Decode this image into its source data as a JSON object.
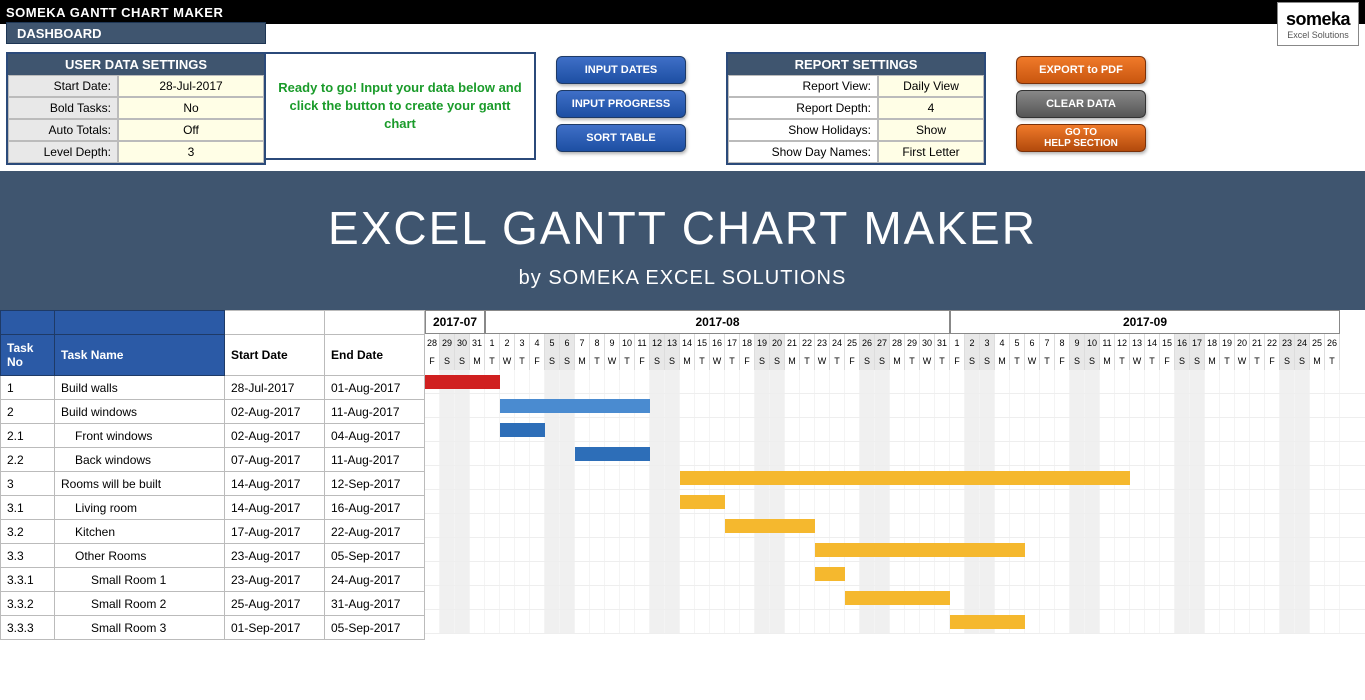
{
  "topbar": {
    "title": "SOMEKA GANTT CHART MAKER"
  },
  "logo": {
    "main": "someka",
    "sub": "Excel Solutions"
  },
  "dashboard_label": "DASHBOARD",
  "user_settings": {
    "header": "USER DATA SETTINGS",
    "rows": [
      {
        "label": "Start Date:",
        "value": "28-Jul-2017"
      },
      {
        "label": "Bold Tasks:",
        "value": "No"
      },
      {
        "label": "Auto Totals:",
        "value": "Off"
      },
      {
        "label": "Level Depth:",
        "value": "3"
      }
    ]
  },
  "message": "Ready to go! Input your data below and click the button to create your gantt chart",
  "buttons_mid": {
    "input_dates": "INPUT DATES",
    "input_progress": "INPUT PROGRESS",
    "sort_table": "SORT TABLE"
  },
  "report_settings": {
    "header": "REPORT SETTINGS",
    "rows": [
      {
        "label": "Report View:",
        "value": "Daily View"
      },
      {
        "label": "Report Depth:",
        "value": "4"
      },
      {
        "label": "Show Holidays:",
        "value": "Show"
      },
      {
        "label": "Show Day Names:",
        "value": "First Letter"
      }
    ]
  },
  "buttons_right": {
    "export": "EXPORT to PDF",
    "clear": "CLEAR DATA",
    "help": "GO TO\nHELP SECTION"
  },
  "hero": {
    "title": "EXCEL GANTT CHART MAKER",
    "subtitle": "by SOMEKA EXCEL SOLUTIONS"
  },
  "columns": {
    "no": "Task No",
    "name": "Task Name",
    "start": "Start Date",
    "end": "End Date"
  },
  "months": [
    {
      "label": "2017-07",
      "days": 4
    },
    {
      "label": "2017-08",
      "days": 31
    },
    {
      "label": "2017-09",
      "days": 26
    }
  ],
  "timeline_start_day": 28,
  "day_numbers": [
    "28",
    "29",
    "30",
    "31",
    "1",
    "2",
    "3",
    "4",
    "5",
    "6",
    "7",
    "8",
    "9",
    "10",
    "11",
    "12",
    "13",
    "14",
    "15",
    "16",
    "17",
    "18",
    "19",
    "20",
    "21",
    "22",
    "23",
    "24",
    "25",
    "26",
    "27",
    "28",
    "29",
    "30",
    "31",
    "1",
    "2",
    "3",
    "4",
    "5",
    "6",
    "7",
    "8",
    "9",
    "10",
    "11",
    "12",
    "13",
    "14",
    "15",
    "16",
    "17",
    "18",
    "19",
    "20",
    "21",
    "22",
    "23",
    "24",
    "25",
    "26"
  ],
  "day_names": [
    "F",
    "S",
    "S",
    "M",
    "T",
    "W",
    "T",
    "F",
    "S",
    "S",
    "M",
    "T",
    "W",
    "T",
    "F",
    "S",
    "S",
    "M",
    "T",
    "W",
    "T",
    "F",
    "S",
    "S",
    "M",
    "T",
    "W",
    "T",
    "F",
    "S",
    "S",
    "M",
    "T",
    "W",
    "T",
    "F",
    "S",
    "S",
    "M",
    "T",
    "W",
    "T",
    "F",
    "S",
    "S",
    "M",
    "T",
    "W",
    "T",
    "F",
    "S",
    "S",
    "M",
    "T",
    "W",
    "T",
    "F",
    "S",
    "S",
    "M",
    "T"
  ],
  "weekends": [
    1,
    2,
    8,
    9,
    15,
    16,
    22,
    23,
    29,
    30,
    36,
    37,
    43,
    44,
    50,
    51,
    57,
    58
  ],
  "tasks": [
    {
      "no": "1",
      "name": "Build walls",
      "indent": 0,
      "start": "28-Jul-2017",
      "end": "01-Aug-2017",
      "bar_start": 0,
      "bar_len": 5,
      "color": "red"
    },
    {
      "no": "2",
      "name": "Build windows",
      "indent": 0,
      "start": "02-Aug-2017",
      "end": "11-Aug-2017",
      "bar_start": 5,
      "bar_len": 10,
      "color": "blue"
    },
    {
      "no": "2.1",
      "name": "Front windows",
      "indent": 1,
      "start": "02-Aug-2017",
      "end": "04-Aug-2017",
      "bar_start": 5,
      "bar_len": 3,
      "color": "blue-dk"
    },
    {
      "no": "2.2",
      "name": "Back windows",
      "indent": 1,
      "start": "07-Aug-2017",
      "end": "11-Aug-2017",
      "bar_start": 10,
      "bar_len": 5,
      "color": "blue-dk"
    },
    {
      "no": "3",
      "name": "Rooms will be built",
      "indent": 0,
      "start": "14-Aug-2017",
      "end": "12-Sep-2017",
      "bar_start": 17,
      "bar_len": 30,
      "color": "orange"
    },
    {
      "no": "3.1",
      "name": "Living room",
      "indent": 1,
      "start": "14-Aug-2017",
      "end": "16-Aug-2017",
      "bar_start": 17,
      "bar_len": 3,
      "color": "orange"
    },
    {
      "no": "3.2",
      "name": "Kitchen",
      "indent": 1,
      "start": "17-Aug-2017",
      "end": "22-Aug-2017",
      "bar_start": 20,
      "bar_len": 6,
      "color": "orange"
    },
    {
      "no": "3.3",
      "name": "Other Rooms",
      "indent": 1,
      "start": "23-Aug-2017",
      "end": "05-Sep-2017",
      "bar_start": 26,
      "bar_len": 14,
      "color": "orange"
    },
    {
      "no": "3.3.1",
      "name": "Small Room 1",
      "indent": 2,
      "start": "23-Aug-2017",
      "end": "24-Aug-2017",
      "bar_start": 26,
      "bar_len": 2,
      "color": "orange"
    },
    {
      "no": "3.3.2",
      "name": "Small Room 2",
      "indent": 2,
      "start": "25-Aug-2017",
      "end": "31-Aug-2017",
      "bar_start": 28,
      "bar_len": 7,
      "color": "orange"
    },
    {
      "no": "3.3.3",
      "name": "Small Room 3",
      "indent": 2,
      "start": "01-Sep-2017",
      "end": "05-Sep-2017",
      "bar_start": 35,
      "bar_len": 5,
      "color": "orange"
    }
  ]
}
